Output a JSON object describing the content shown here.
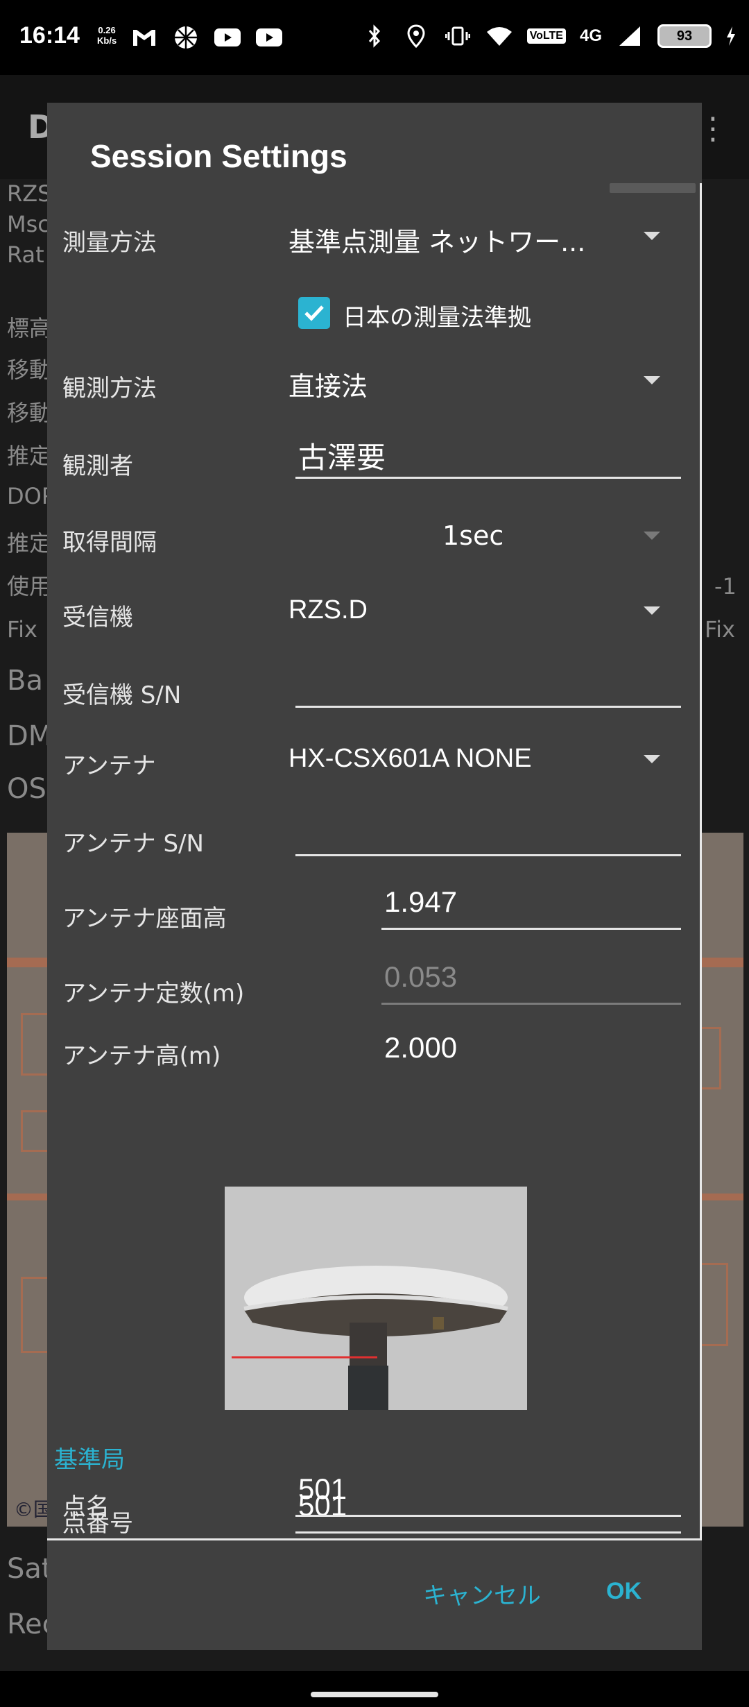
{
  "status_bar": {
    "time": "16:14",
    "net_speed_value": "0.26",
    "net_speed_unit": "Kb/s",
    "left_icons": [
      "gmail-icon",
      "pinwheel-icon",
      "youtube-icon",
      "youtube-icon"
    ],
    "right_icons": [
      "bluetooth-icon",
      "location-icon",
      "vibrate-icon",
      "wifi-icon"
    ],
    "volte": "VoLTE",
    "network": "4G",
    "battery": "93"
  },
  "background_app": {
    "title_initial": "D",
    "labels": [
      "RZS",
      "Msc",
      "Rat",
      "標高",
      "移動",
      "移動",
      "推定",
      "DOP",
      "推定",
      "使用",
      "Fix",
      "Ba",
      "DM",
      "OS",
      "Sat",
      "Rec"
    ],
    "right_values": [
      "-1",
      "Fix"
    ],
    "map_copyright": "©国"
  },
  "dialog": {
    "title": "Session Settings",
    "survey_method": {
      "label": "測量方法",
      "value": "基準点測量 ネットワー..."
    },
    "japan_law": {
      "label": "日本の測量法準拠",
      "checked": true
    },
    "observation_method": {
      "label": "観測方法",
      "value": "直接法"
    },
    "observer": {
      "label": "観測者",
      "value": "古澤要"
    },
    "interval": {
      "label": "取得間隔",
      "value": "1sec"
    },
    "receiver": {
      "label": "受信機",
      "value": "RZS.D"
    },
    "receiver_sn": {
      "label": "受信機 S/N",
      "value": ""
    },
    "antenna": {
      "label": "アンテナ",
      "value": "HX-CSX601A NONE"
    },
    "antenna_sn": {
      "label": "アンテナ S/N",
      "value": ""
    },
    "antenna_mount_height": {
      "label": "アンテナ座面高",
      "value": "1.947"
    },
    "antenna_constant": {
      "label": "アンテナ定数(m)",
      "value": "0.053"
    },
    "antenna_height": {
      "label": "アンテナ高(m)",
      "value": "2.000"
    },
    "base_station_header": "基準局",
    "point_number": {
      "label": "点番号",
      "value": "501"
    },
    "point_name": {
      "label": "点名",
      "value": "501"
    },
    "cancel_label": "キャンセル",
    "ok_label": "OK"
  },
  "colors": {
    "accent": "#2bb3d1",
    "dialog_bg": "#404040"
  }
}
